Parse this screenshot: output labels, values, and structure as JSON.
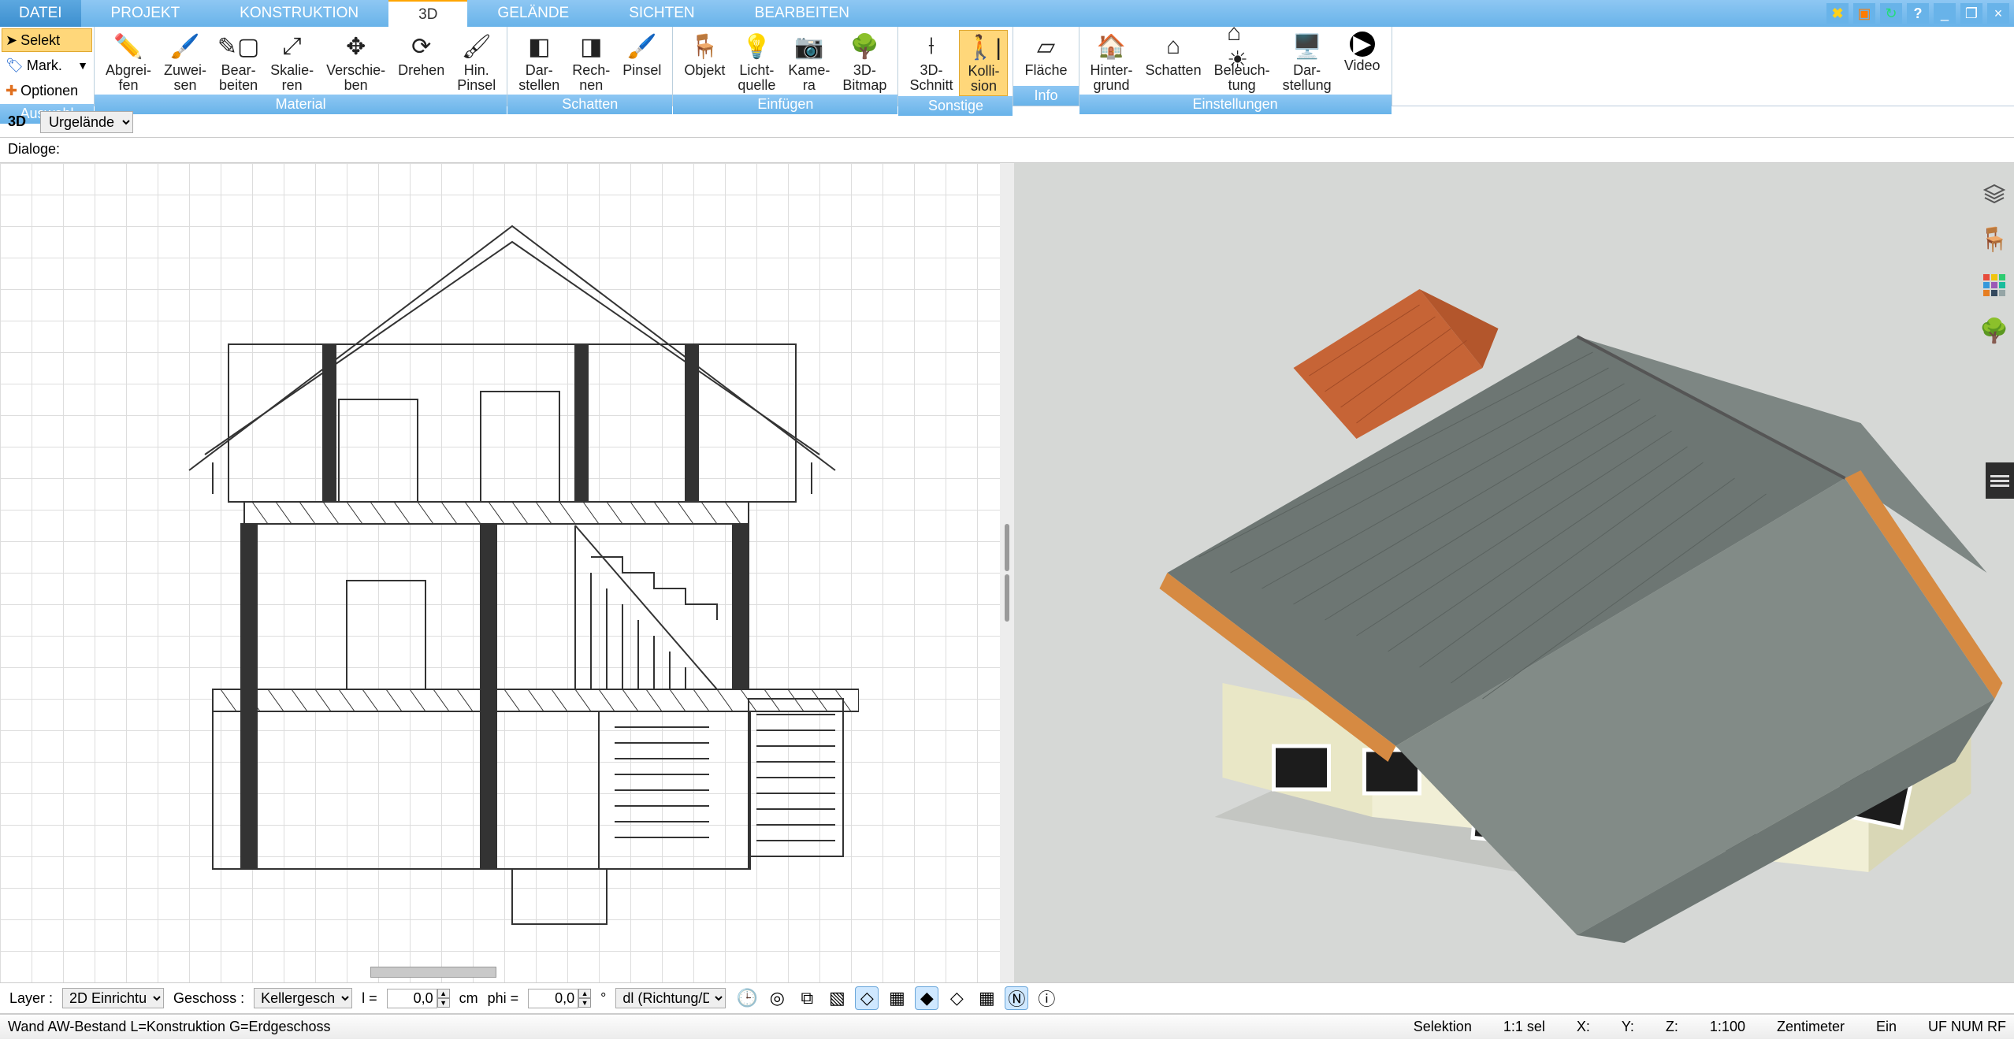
{
  "menu": {
    "datei": "DATEI",
    "projekt": "PROJEKT",
    "konstruktion": "KONSTRUKTION",
    "dreid": "3D",
    "gelaende": "GELÄNDE",
    "sichten": "SICHTEN",
    "bearbeiten": "BEARBEITEN"
  },
  "toolcol": {
    "selekt": "Selekt",
    "mark": "Mark.",
    "optionen": "Optionen"
  },
  "ribbon": {
    "material": {
      "abgreifen": "Abgrei-\nfen",
      "zuweisen": "Zuwei-\nsen",
      "bearbeiten": "Bear-\nbeiten",
      "skalieren": "Skalie-\nren",
      "verschieben": "Verschie-\nben",
      "drehen": "Drehen",
      "hinpinsel": "Hin.\nPinsel",
      "caption": "Material"
    },
    "auswahl_caption": "Auswahl",
    "schatten": {
      "darstellen": "Dar-\nstellen",
      "rechnen": "Rech-\nnen",
      "pinsel": "Pinsel",
      "caption": "Schatten"
    },
    "einfuegen": {
      "objekt": "Objekt",
      "lichtquelle": "Licht-\nquelle",
      "kamera": "Kame-\nra",
      "bitmap3d": "3D-\nBitmap",
      "caption": "Einfügen"
    },
    "sonstige": {
      "schnitt3d": "3D-\nSchnitt",
      "kollision": "Kolli-\nsion",
      "caption": "Sonstige"
    },
    "info": {
      "flaeche": "Fläche",
      "caption": "Info"
    },
    "einstellungen": {
      "hintergrund": "Hinter-\ngrund",
      "schatten": "Schatten",
      "beleuchtung": "Beleuch-\ntung",
      "darstellung": "Dar-\nstellung",
      "video": "Video",
      "caption": "Einstellungen"
    }
  },
  "subbar": {
    "label3d": "3D",
    "dropdown": "Urgelände"
  },
  "dialoge": "Dialoge:",
  "bottombar": {
    "layer_label": "Layer :",
    "layer_value": "2D Einrichtu",
    "geschoss_label": "Geschoss :",
    "geschoss_value": "Kellergesch",
    "l_label": "l =",
    "l_value": "0,0",
    "cm": "cm",
    "phi_label": "phi =",
    "phi_value": "0,0",
    "deg": "°",
    "richtung": "dl (Richtung/Di"
  },
  "statusbar": {
    "left": "Wand AW-Bestand L=Konstruktion G=Erdgeschoss",
    "selektion": "Selektion",
    "sel": "1:1 sel",
    "x": "X:",
    "y": "Y:",
    "z": "Z:",
    "scale": "1:100",
    "unit": "Zentimeter",
    "ein": "Ein",
    "uf": "UF NUM RF"
  }
}
